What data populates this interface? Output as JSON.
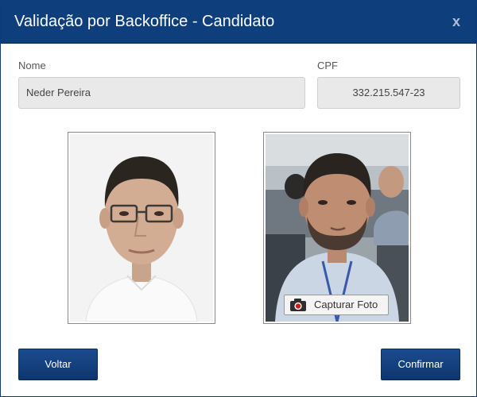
{
  "dialog": {
    "title": "Validação por Backoffice - Candidato",
    "close_label": "x"
  },
  "form": {
    "nome_label": "Nome",
    "nome_value": "Neder Pereira",
    "cpf_label": "CPF",
    "cpf_value": "332.215.547-23"
  },
  "photos": {
    "capture_label": "Capturar Foto"
  },
  "buttons": {
    "back_label": "Voltar",
    "confirm_label": "Confirmar"
  },
  "colors": {
    "titlebar": "#0f3e7c",
    "button": "#0d3670",
    "record_dot": "#d01a1a"
  }
}
